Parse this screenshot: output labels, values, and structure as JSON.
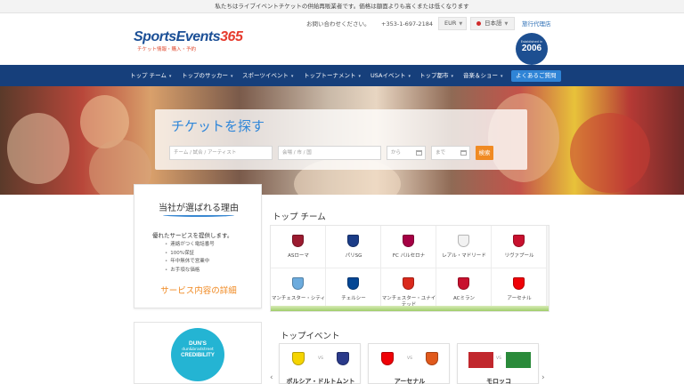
{
  "notice": {
    "text": "私たちはライブイベントチケットの供給再販業者です。価格は額面よりも高くまたは低くなります"
  },
  "header": {
    "logo": {
      "brand_a": "SportsEvents",
      "brand_b": "365",
      "tagline": "チケット情報・購入・予約"
    },
    "contact": "お問い合わせください。",
    "phone": "+353-1-697-2184",
    "currency": "EUR",
    "language": "日本語",
    "agent_link": "旅行代理店",
    "badge": {
      "label": "Established in",
      "year": "2006"
    }
  },
  "nav": {
    "items": [
      "トップ チーム",
      "トップのサッカー",
      "スポーツイベント",
      "トップトーナメント",
      "USAイベント",
      "トップ都市",
      "音楽＆ショー"
    ],
    "faq": "よくあるご質問"
  },
  "search": {
    "title": "チケットを探す",
    "query_placeholder": "チーム / 試合 / アーティスト",
    "venue_placeholder": "会場 / 市 / 国",
    "from_placeholder": "から",
    "to_placeholder": "まで",
    "button": "検索"
  },
  "why": {
    "title": "当社が選ばれる理由",
    "lead": "優れたサービスを提供します。",
    "points": [
      "連絡がつく電話番号",
      "100%保証",
      "年中無休で営業中",
      "お手頃な価格"
    ],
    "link": "サービス内容の詳細"
  },
  "dun": {
    "line1": "DUN'S",
    "line2": "dun&bradstreet",
    "line3": "CREDIBILITY"
  },
  "top_teams": {
    "title": "トップ チーム",
    "teams": [
      {
        "name": "ASローマ",
        "color": "#9b1b30"
      },
      {
        "name": "パリSG",
        "color": "#1b3c87"
      },
      {
        "name": "FC バルセロナ",
        "color": "#a50044"
      },
      {
        "name": "レアル・マドリード",
        "color": "#f2f2f2"
      },
      {
        "name": "リヴァプール",
        "color": "#c8102e"
      },
      {
        "name": "マンチェスター・シティ",
        "color": "#6cabdd"
      },
      {
        "name": "チェルシー",
        "color": "#034694"
      },
      {
        "name": "マンチェスター・ユナイテッド",
        "color": "#da291c"
      },
      {
        "name": "ACミラン",
        "color": "#c8102e"
      },
      {
        "name": "アーセナル",
        "color": "#ef0107"
      }
    ]
  },
  "top_events": {
    "title": "トップイベント",
    "events": [
      {
        "name": "ボルシア・ドルトムント",
        "vs": "VS",
        "home": "#f5d400",
        "away": "#2a3a8a"
      },
      {
        "name": "アーセナル",
        "vs": "VS",
        "home": "#ef0107",
        "away": "#e0591c"
      },
      {
        "name": "モロッコ",
        "vs": "VS",
        "home": "#c1272d",
        "away": "#2a8a3a"
      }
    ]
  }
}
